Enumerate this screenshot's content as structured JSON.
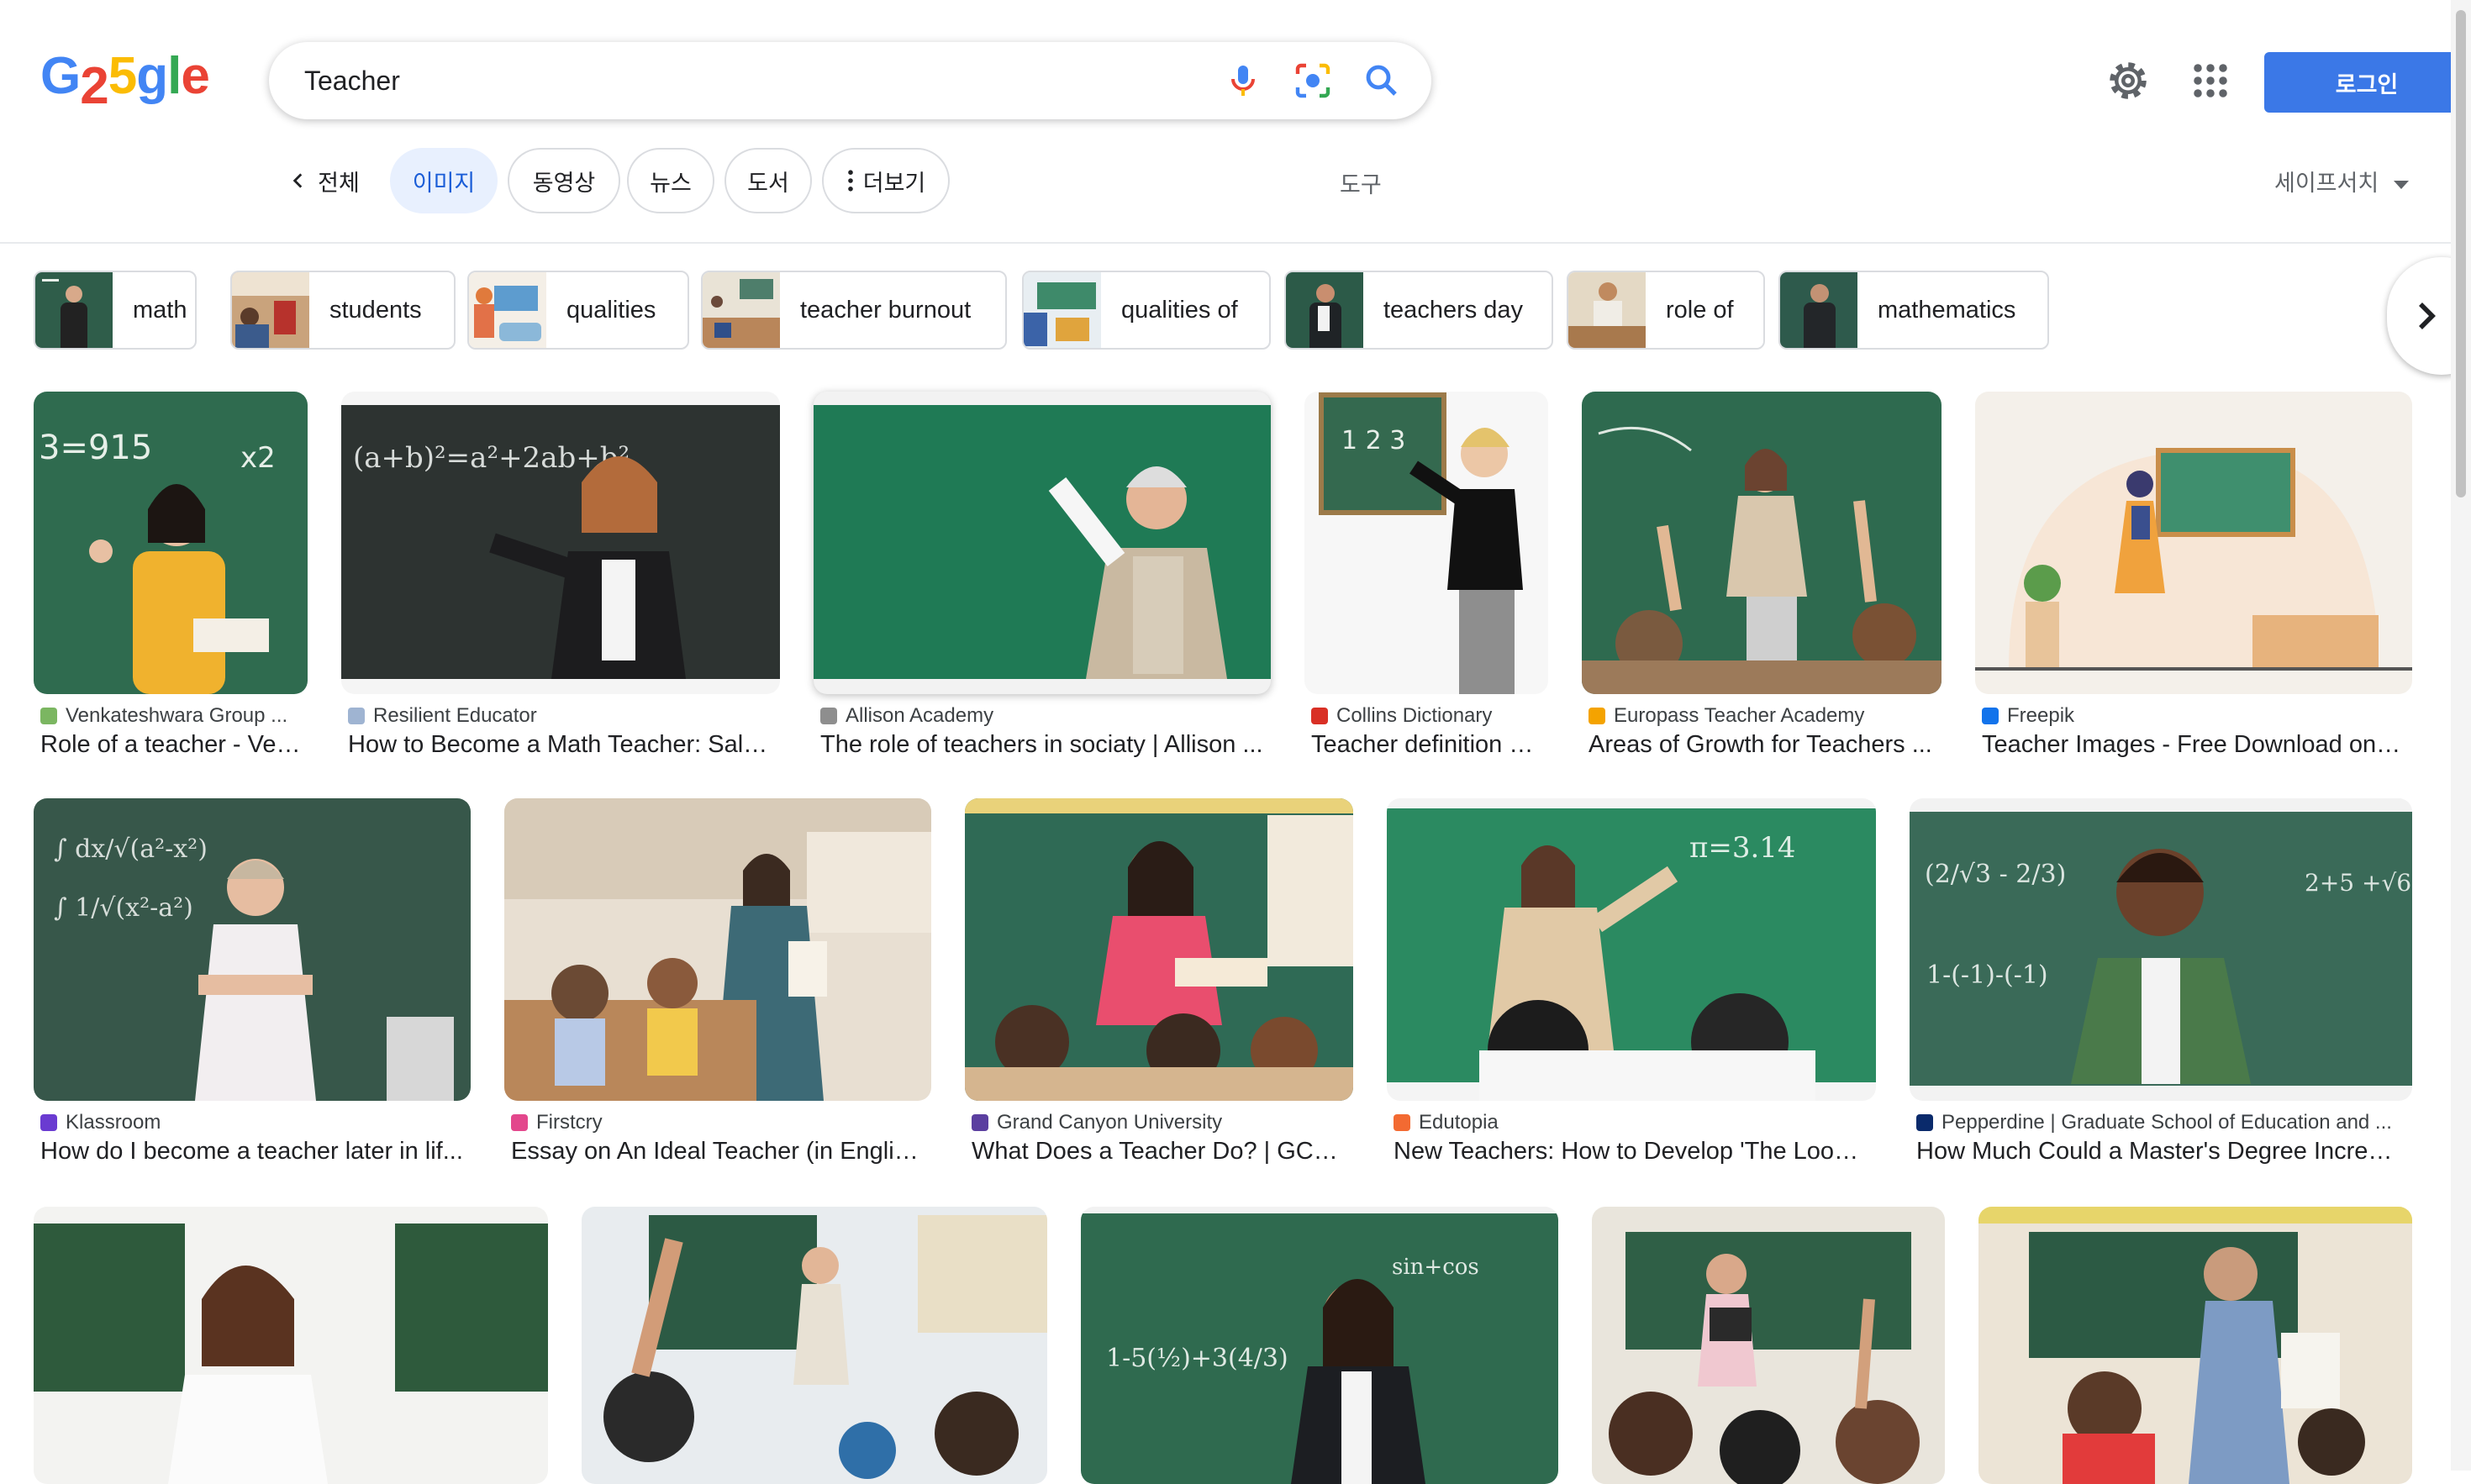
{
  "logo": {
    "letters": [
      "G",
      "2",
      "5",
      "g",
      "l",
      "e"
    ],
    "colors": [
      "#4285f4",
      "#ea4335",
      "#fbbc05",
      "#4285f4",
      "#34a853",
      "#ea4335"
    ]
  },
  "search": {
    "query": "Teacher",
    "icons": [
      "microphone-icon",
      "lens-icon",
      "search-icon"
    ]
  },
  "header": {
    "icons": [
      "gear-icon",
      "apps-grid-icon"
    ],
    "login_label": "로그인"
  },
  "tabs": {
    "back_label": "전체",
    "items": [
      "이미지",
      "동영상",
      "뉴스",
      "도서",
      "더보기"
    ],
    "more_icon": "more-vert-icon",
    "active": "이미지",
    "tools_label": "도구",
    "safesearch_label": "세이프서치"
  },
  "chips": [
    "math",
    "students",
    "qualities",
    "teacher burnout",
    "qualities of",
    "teachers day",
    "role of",
    "mathematics"
  ],
  "results": [
    {
      "source": "Venkateshwara Group ...",
      "title": "Role of a teacher - Ven..."
    },
    {
      "source": "Resilient Educator",
      "title": "How to Become a Math Teacher: Sala..."
    },
    {
      "source": "Allison Academy",
      "title": "The role of teachers in sociaty | Allison ..."
    },
    {
      "source": "Collins Dictionary",
      "title": "Teacher definition a..."
    },
    {
      "source": "Europass Teacher Academy",
      "title": "Areas of Growth for Teachers ..."
    },
    {
      "source": "Freepik",
      "title": "Teacher Images - Free Download on F..."
    },
    {
      "source": "Klassroom",
      "title": "How do I become a teacher later in lif..."
    },
    {
      "source": "Firstcry",
      "title": "Essay on An Ideal Teacher (in Englis..."
    },
    {
      "source": "Grand Canyon University",
      "title": "What Does a Teacher Do? | GCU ..."
    },
    {
      "source": "Edutopia",
      "title": "New Teachers: How to Develop 'The Look' ..."
    },
    {
      "source": "Pepperdine | Graduate School of Education and ...",
      "title": "How Much Could a Master's Degree Increas..."
    },
    {
      "source": "",
      "title": ""
    }
  ],
  "colors": {
    "accent": "#3b78e7",
    "active_tab_bg": "#e8f0fe",
    "chalkboard": "#2f6b4f"
  }
}
